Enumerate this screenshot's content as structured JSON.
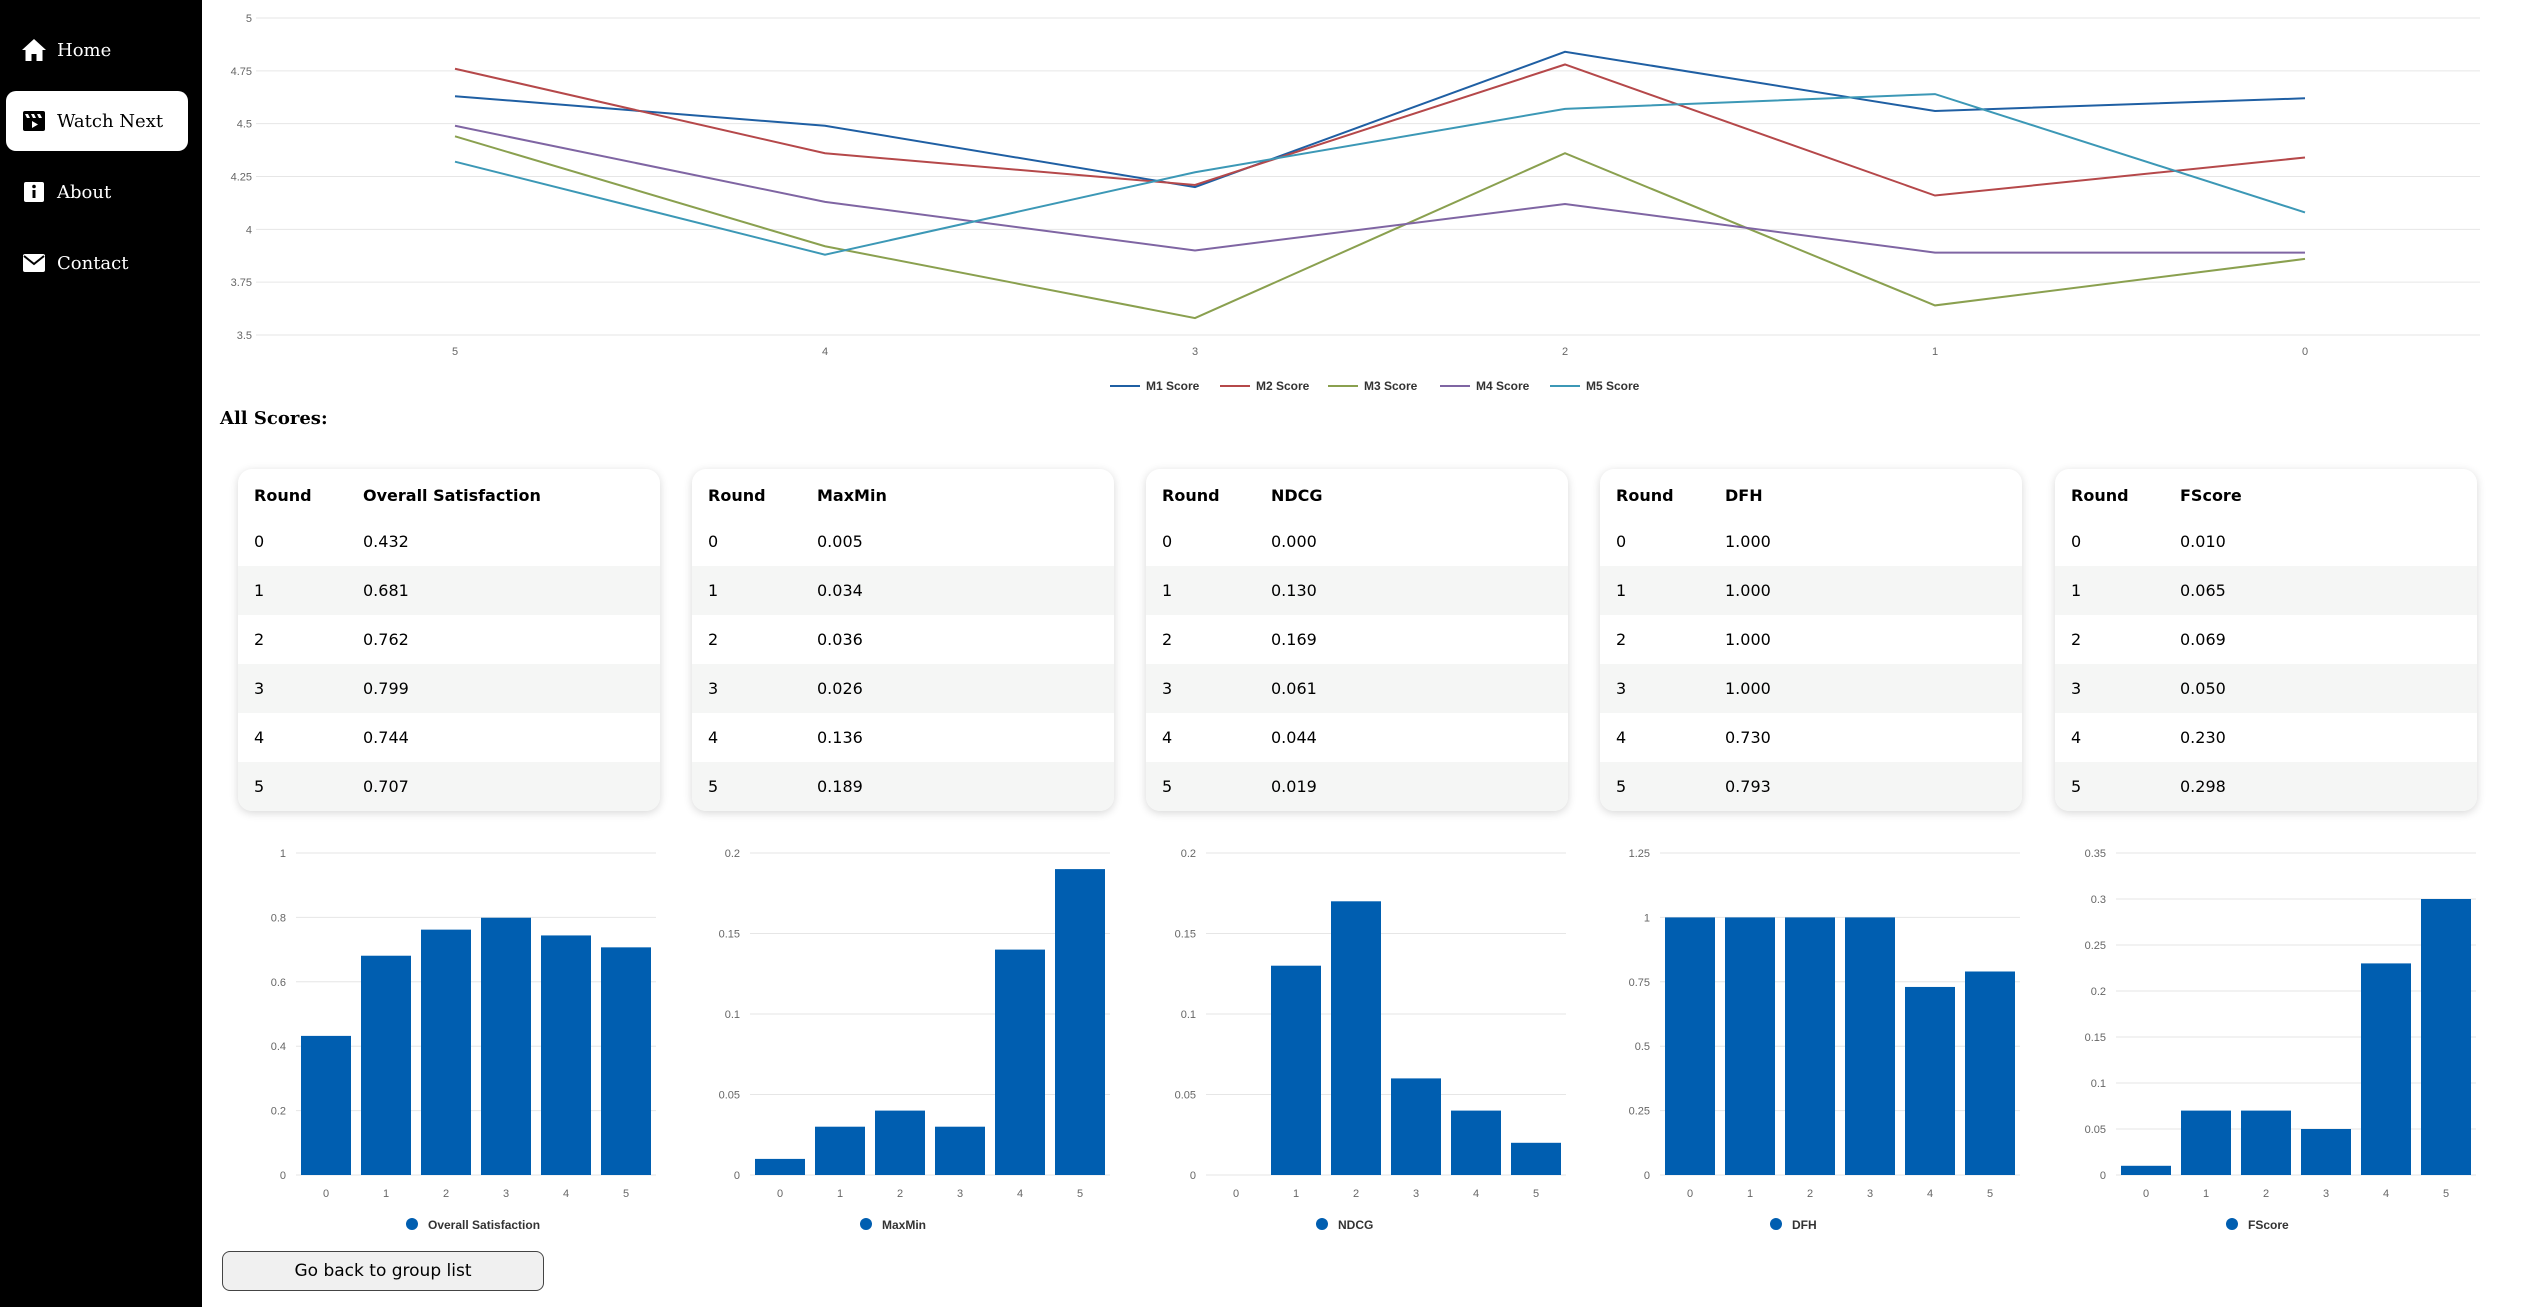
{
  "sidebar": {
    "items": [
      {
        "label": "Home",
        "icon": "home-icon"
      },
      {
        "label": "Watch Next",
        "icon": "clapperboard-icon",
        "active": true
      },
      {
        "label": "About",
        "icon": "info-icon"
      },
      {
        "label": "Contact",
        "icon": "envelope-icon"
      }
    ]
  },
  "line_chart": {
    "type": "line",
    "x": [
      "5",
      "4",
      "3",
      "2",
      "1",
      "0"
    ],
    "ylim": [
      3.5,
      5
    ],
    "y_ticks": [
      "3.5",
      "3.75",
      "4",
      "4.25",
      "4.5",
      "4.75",
      "5"
    ],
    "grid": true,
    "legend_position": "bottom",
    "series": [
      {
        "name": "M1 Score",
        "color": "#1f5fa3",
        "values": [
          4.63,
          4.49,
          4.2,
          4.84,
          4.56,
          4.62
        ]
      },
      {
        "name": "M2 Score",
        "color": "#b5484a",
        "values": [
          4.76,
          4.36,
          4.21,
          4.78,
          4.16,
          4.34
        ]
      },
      {
        "name": "M3 Score",
        "color": "#8aa04f",
        "values": [
          4.44,
          3.92,
          3.58,
          4.36,
          3.64,
          3.86
        ]
      },
      {
        "name": "M4 Score",
        "color": "#7f65a3",
        "values": [
          4.49,
          4.13,
          3.9,
          4.12,
          3.89,
          3.89
        ]
      },
      {
        "name": "M5 Score",
        "color": "#3c98b6",
        "values": [
          4.32,
          3.88,
          4.27,
          4.57,
          4.64,
          4.08
        ]
      }
    ]
  },
  "section_title": "All Scores:",
  "tables": [
    {
      "headers": [
        "Round",
        "Overall Satisfaction"
      ],
      "rows": [
        [
          "0",
          "0.432"
        ],
        [
          "1",
          "0.681"
        ],
        [
          "2",
          "0.762"
        ],
        [
          "3",
          "0.799"
        ],
        [
          "4",
          "0.744"
        ],
        [
          "5",
          "0.707"
        ]
      ]
    },
    {
      "headers": [
        "Round",
        "MaxMin"
      ],
      "rows": [
        [
          "0",
          "0.005"
        ],
        [
          "1",
          "0.034"
        ],
        [
          "2",
          "0.036"
        ],
        [
          "3",
          "0.026"
        ],
        [
          "4",
          "0.136"
        ],
        [
          "5",
          "0.189"
        ]
      ]
    },
    {
      "headers": [
        "Round",
        "NDCG"
      ],
      "rows": [
        [
          "0",
          "0.000"
        ],
        [
          "1",
          "0.130"
        ],
        [
          "2",
          "0.169"
        ],
        [
          "3",
          "0.061"
        ],
        [
          "4",
          "0.044"
        ],
        [
          "5",
          "0.019"
        ]
      ]
    },
    {
      "headers": [
        "Round",
        "DFH"
      ],
      "rows": [
        [
          "0",
          "1.000"
        ],
        [
          "1",
          "1.000"
        ],
        [
          "2",
          "1.000"
        ],
        [
          "3",
          "1.000"
        ],
        [
          "4",
          "0.730"
        ],
        [
          "5",
          "0.793"
        ]
      ]
    },
    {
      "headers": [
        "Round",
        "FScore"
      ],
      "rows": [
        [
          "0",
          "0.010"
        ],
        [
          "1",
          "0.065"
        ],
        [
          "2",
          "0.069"
        ],
        [
          "3",
          "0.050"
        ],
        [
          "4",
          "0.230"
        ],
        [
          "5",
          "0.298"
        ]
      ]
    }
  ],
  "chart_data": [
    {
      "type": "line",
      "x": [
        "5",
        "4",
        "3",
        "2",
        "1",
        "0"
      ],
      "ylim": [
        3.5,
        5
      ],
      "series": [
        {
          "name": "M1 Score",
          "values": [
            4.63,
            4.49,
            4.2,
            4.84,
            4.56,
            4.62
          ]
        },
        {
          "name": "M2 Score",
          "values": [
            4.76,
            4.36,
            4.21,
            4.78,
            4.16,
            4.34
          ]
        },
        {
          "name": "M3 Score",
          "values": [
            4.44,
            3.92,
            3.58,
            4.36,
            3.64,
            3.86
          ]
        },
        {
          "name": "M4 Score",
          "values": [
            4.49,
            4.13,
            3.9,
            4.12,
            3.89,
            3.89
          ]
        },
        {
          "name": "M5 Score",
          "values": [
            4.32,
            3.88,
            4.27,
            4.57,
            4.64,
            4.08
          ]
        }
      ]
    },
    {
      "type": "bar",
      "name": "Overall Satisfaction",
      "categories": [
        "0",
        "1",
        "2",
        "3",
        "4",
        "5"
      ],
      "values": [
        0.432,
        0.681,
        0.762,
        0.799,
        0.744,
        0.707
      ],
      "ylim": [
        0,
        1
      ],
      "y_ticks": [
        "0",
        "0.2",
        "0.4",
        "0.6",
        "0.8",
        "1"
      ],
      "color": "#005eb0"
    },
    {
      "type": "bar",
      "name": "MaxMin",
      "categories": [
        "0",
        "1",
        "2",
        "3",
        "4",
        "5"
      ],
      "values": [
        0.01,
        0.03,
        0.04,
        0.03,
        0.14,
        0.19
      ],
      "ylim": [
        0,
        0.2
      ],
      "y_ticks": [
        "0",
        "0.05",
        "0.1",
        "0.15",
        "0.2"
      ],
      "color": "#005eb0"
    },
    {
      "type": "bar",
      "name": "NDCG",
      "categories": [
        "0",
        "1",
        "2",
        "3",
        "4",
        "5"
      ],
      "values": [
        0,
        0.13,
        0.17,
        0.06,
        0.04,
        0.02
      ],
      "ylim": [
        0,
        0.2
      ],
      "y_ticks": [
        "0",
        "0.05",
        "0.1",
        "0.15",
        "0.2"
      ],
      "color": "#005eb0"
    },
    {
      "type": "bar",
      "name": "DFH",
      "categories": [
        "0",
        "1",
        "2",
        "3",
        "4",
        "5"
      ],
      "values": [
        1,
        1,
        1,
        1,
        0.73,
        0.79
      ],
      "ylim": [
        0,
        1.25
      ],
      "y_ticks": [
        "0",
        "0.25",
        "0.5",
        "0.75",
        "1",
        "1.25"
      ],
      "color": "#005eb0"
    },
    {
      "type": "bar",
      "name": "FScore",
      "categories": [
        "0",
        "1",
        "2",
        "3",
        "4",
        "5"
      ],
      "values": [
        0.01,
        0.07,
        0.07,
        0.05,
        0.23,
        0.3
      ],
      "ylim": [
        0,
        0.35
      ],
      "y_ticks": [
        "0",
        "0.05",
        "0.1",
        "0.15",
        "0.2",
        "0.25",
        "0.3",
        "0.35"
      ],
      "color": "#005eb0"
    }
  ],
  "back_button": {
    "label": "Go back to group list"
  }
}
